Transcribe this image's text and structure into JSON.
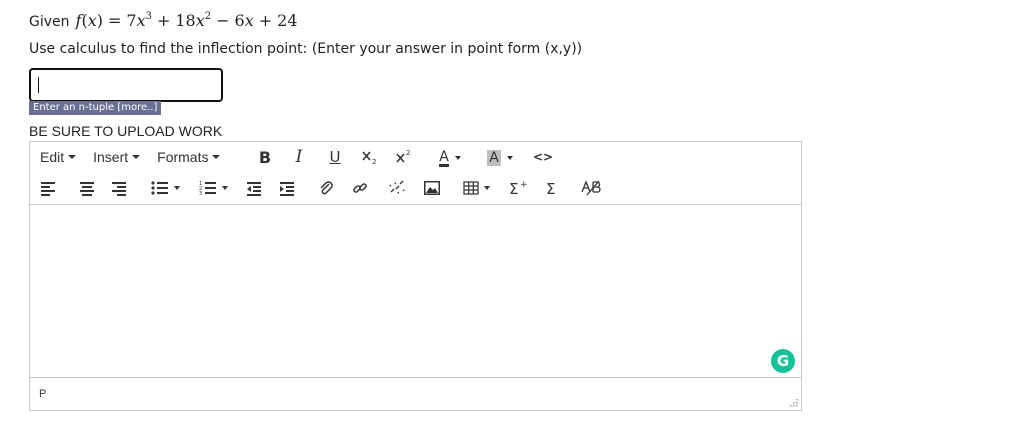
{
  "question": {
    "lead": "Given",
    "function_name": "f",
    "variable": "x",
    "equals": "=",
    "terms": [
      {
        "coef": "7",
        "var": "x",
        "exp": "3",
        "op": "+"
      },
      {
        "coef": "18",
        "var": "x",
        "exp": "2",
        "op": "−"
      },
      {
        "coef": "6",
        "var": "x",
        "exp": "",
        "op": "+"
      },
      {
        "coef": "24",
        "var": "",
        "exp": "",
        "op": ""
      }
    ],
    "instruction": "Use calculus to find the inflection point: (Enter your answer in point form (x,y))"
  },
  "answer": {
    "value": "",
    "hint": "Enter an n-tuple [more..]"
  },
  "upload_note": "BE SURE TO UPLOAD WORK",
  "editor": {
    "menus": [
      "Edit",
      "Insert",
      "Formats"
    ],
    "toolbar_row1": {
      "bold": "B",
      "italic": "I",
      "underline": "U",
      "text_color": "A",
      "bg_color": "A",
      "code": "<>"
    },
    "status_path": "P",
    "colors": {
      "grammarly": "#15c39a",
      "hint_bg": "#6b6f91",
      "border": "#c9c9c9"
    },
    "grammarly_letter": "G"
  }
}
